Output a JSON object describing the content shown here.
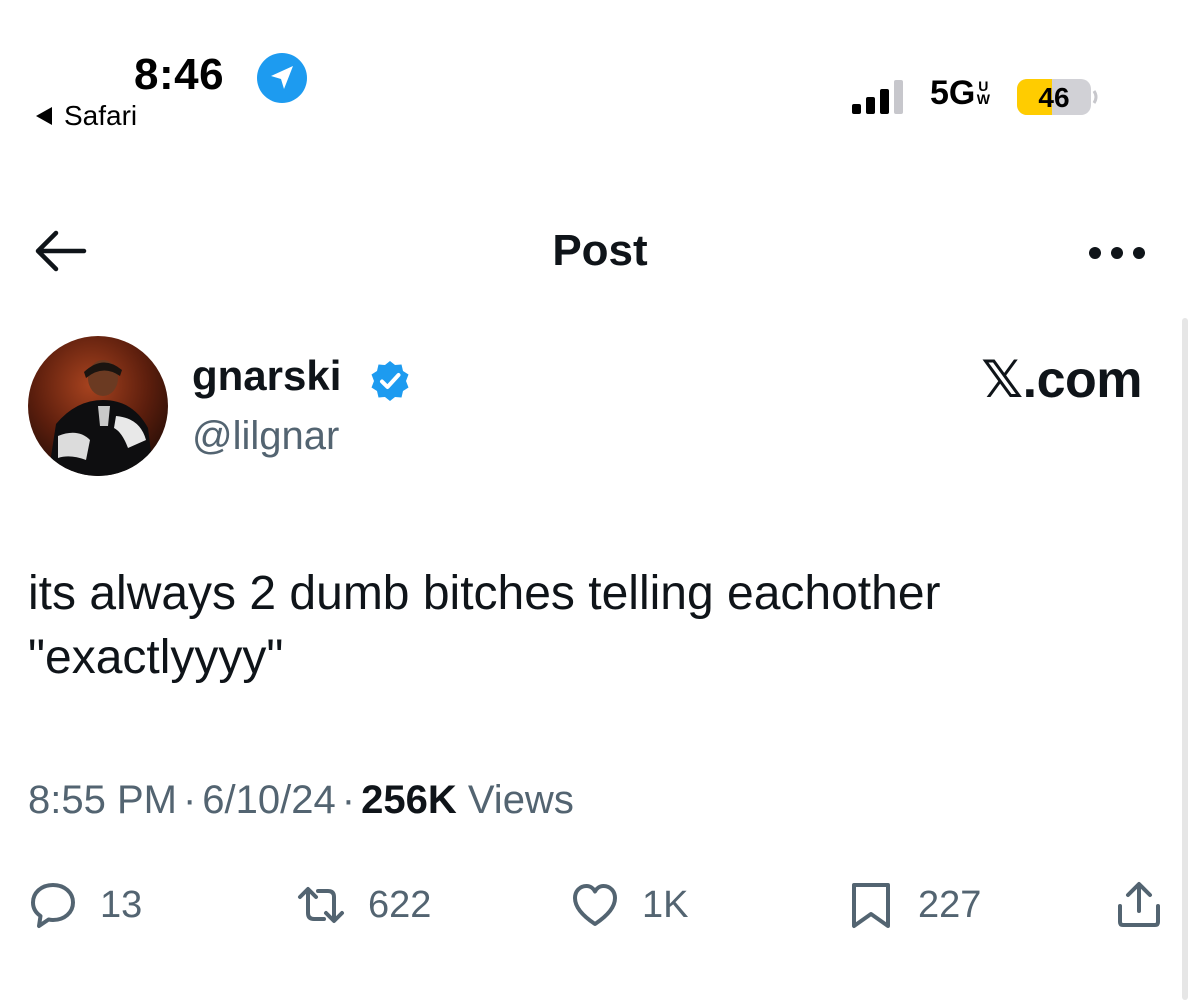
{
  "status_bar": {
    "time": "8:46",
    "back_app": "Safari",
    "network": "5G",
    "network_suffix": "UW",
    "battery": "46",
    "battery_color": "#ffcc00"
  },
  "header": {
    "title": "Post"
  },
  "post": {
    "display_name": "gnarski",
    "handle": "@lilgnar",
    "watermark": "𝕏.com",
    "text": "its always 2 dumb bitches telling eachother \"exactlyyyy\"",
    "time": "8:55 PM",
    "separator": "·",
    "date": "6/10/24",
    "views_count": "256K",
    "views_label": "Views"
  },
  "actions": {
    "replies": "13",
    "reposts": "622",
    "likes": "1K",
    "bookmarks": "227"
  },
  "colors": {
    "accent": "#1d9bf0",
    "text": "#0f1419",
    "muted": "#536471"
  },
  "icons": [
    "location-arrow-icon",
    "cellular-signal-icon",
    "battery-icon",
    "back-arrow-icon",
    "more-icon",
    "verified-badge-icon",
    "reply-icon",
    "repost-icon",
    "like-icon",
    "bookmark-icon",
    "share-icon"
  ]
}
